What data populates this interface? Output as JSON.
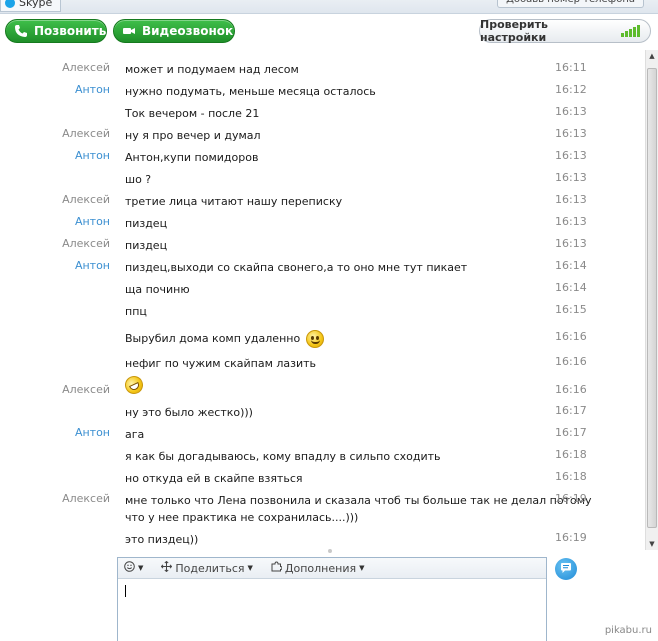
{
  "window": {
    "tab_title": "Skype",
    "add_phone": "Добавь номер телефона"
  },
  "toolbar": {
    "call_label": "Позвонить",
    "video_label": "Видеозвонок",
    "settings_label": "Проверить настройки"
  },
  "messages": [
    {
      "sender": "Алексей",
      "text": "может и подумаем над лесом",
      "time": "16:11"
    },
    {
      "sender": "Антон",
      "text": "нужно подумать, меньше месяца осталось",
      "time": "16:12"
    },
    {
      "sender": "",
      "text": "Ток вечером - после 21",
      "time": "16:13"
    },
    {
      "sender": "Алексей",
      "text": "ну я про вечер и думал",
      "time": "16:13"
    },
    {
      "sender": "Антон",
      "text": "Антон,купи помидоров",
      "time": "16:13"
    },
    {
      "sender": "",
      "text": "шо ?",
      "time": "16:13"
    },
    {
      "sender": "Алексей",
      "text": "третие лица читают нашу переписку",
      "time": "16:13"
    },
    {
      "sender": "Антон",
      "text": "пиздец",
      "time": "16:13"
    },
    {
      "sender": "Алексей",
      "text": "пиздец",
      "time": "16:13"
    },
    {
      "sender": "Антон",
      "text": "пиздец,выходи со скайпа свонего,а то оно мне тут пикает",
      "time": "16:14"
    },
    {
      "sender": "",
      "text": "ща починю",
      "time": "16:14"
    },
    {
      "sender": "",
      "text": "ппц",
      "time": "16:15"
    },
    {
      "sender": "",
      "text": "Вырубил дома комп удаленно",
      "time": "16:16"
    },
    {
      "sender": "",
      "text": "нефиг по чужим скайпам лазить",
      "time": "16:16"
    },
    {
      "sender": "Алексей",
      "text": "",
      "time": "16:16"
    },
    {
      "sender": "",
      "text": "ну это было жестко)))",
      "time": "16:17"
    },
    {
      "sender": "Антон",
      "text": "ага",
      "time": "16:17"
    },
    {
      "sender": "",
      "text": "я как бы догадываюсь, кому впадлу в сильпо сходить",
      "time": "16:18"
    },
    {
      "sender": "",
      "text": "но откуда ей в скайпе взяться",
      "time": "16:18"
    },
    {
      "sender": "Алексей",
      "text": "мне только что Лена позвонила и сказала чтоб ты больше так не делал потому",
      "text2": "что у нее практика не сохранилась....)))",
      "time": "16:19"
    },
    {
      "sender": "",
      "text": "это пиздец))",
      "time": "16:19"
    }
  ],
  "compose": {
    "share_label": "Поделиться",
    "addons_label": "Дополнения"
  },
  "watermark": "pikabu.ru",
  "colors": {
    "anton": "#3b8fd1",
    "alexey": "#8a8a8a",
    "green": "#2aa336"
  }
}
